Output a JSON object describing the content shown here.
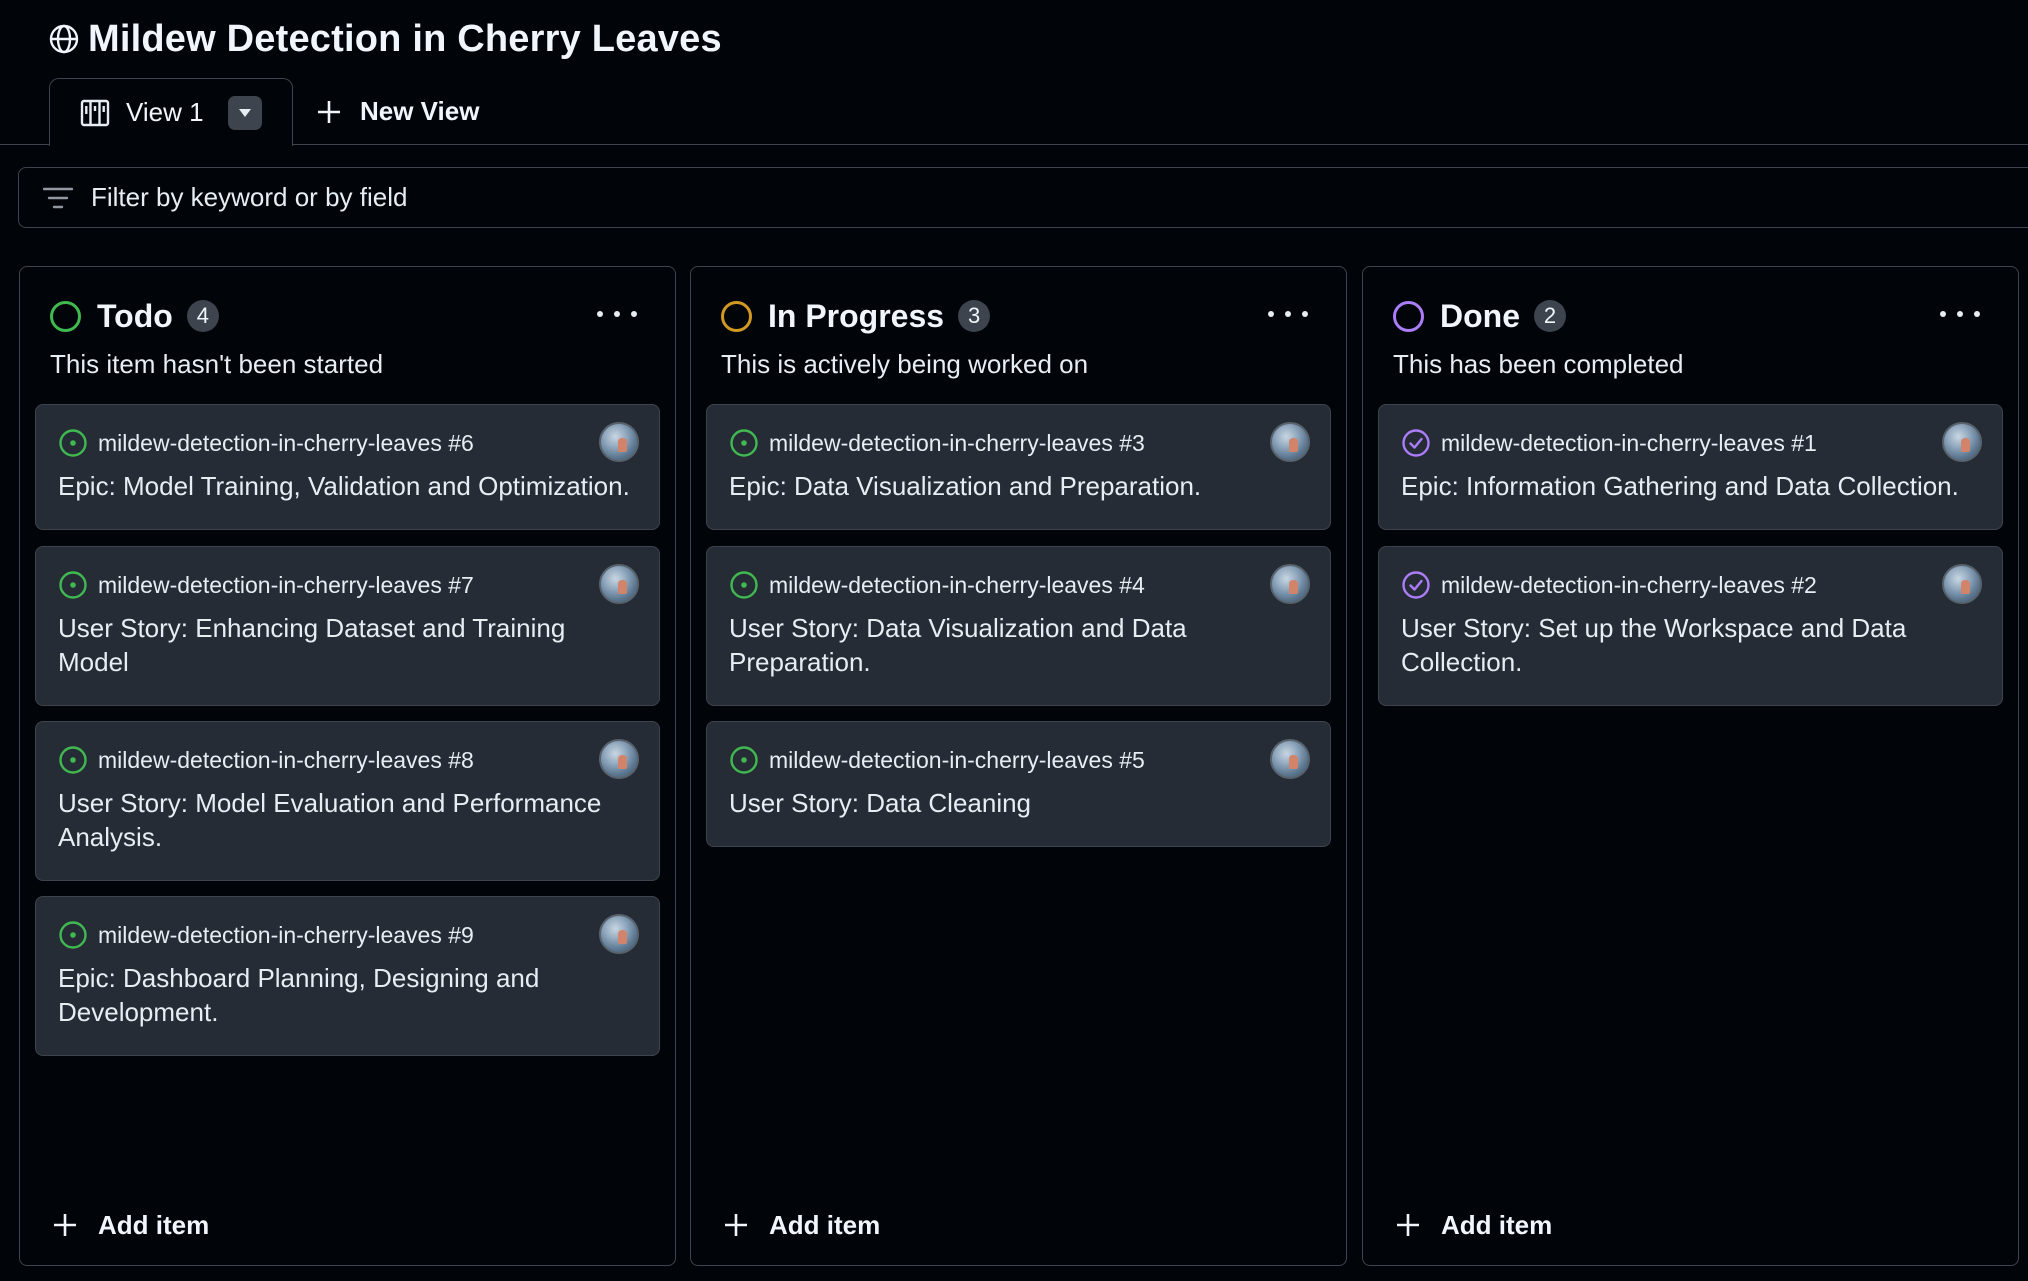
{
  "project": {
    "title": "Mildew Detection in Cherry Leaves"
  },
  "views": {
    "active_label": "View 1",
    "new_view_label": "New View"
  },
  "filter": {
    "placeholder": "Filter by keyword or by field"
  },
  "columns": [
    {
      "name": "Todo",
      "count": "4",
      "description": "This item hasn't been started",
      "status_color": "#3fb950",
      "add_label": "Add item",
      "cards": [
        {
          "ref": "mildew-detection-in-cherry-leaves #6",
          "title": "Epic: Model Training, Validation and Optimization.",
          "state": "open"
        },
        {
          "ref": "mildew-detection-in-cherry-leaves #7",
          "title": "User Story: Enhancing Dataset and Training Model",
          "state": "open"
        },
        {
          "ref": "mildew-detection-in-cherry-leaves #8",
          "title": "User Story: Model Evaluation and Performance Analysis.",
          "state": "open"
        },
        {
          "ref": "mildew-detection-in-cherry-leaves #9",
          "title": "Epic: Dashboard Planning, Designing and Development.",
          "state": "open"
        }
      ]
    },
    {
      "name": "In Progress",
      "count": "3",
      "description": "This is actively being worked on",
      "status_color": "#d29922",
      "add_label": "Add item",
      "cards": [
        {
          "ref": "mildew-detection-in-cherry-leaves #3",
          "title": "Epic: Data Visualization and Preparation.",
          "state": "open"
        },
        {
          "ref": "mildew-detection-in-cherry-leaves #4",
          "title": "User Story: Data Visualization and Data Preparation.",
          "state": "open"
        },
        {
          "ref": "mildew-detection-in-cherry-leaves #5",
          "title": "User Story: Data Cleaning",
          "state": "open"
        }
      ]
    },
    {
      "name": "Done",
      "count": "2",
      "description": "This has been completed",
      "status_color": "#ab7df8",
      "add_label": "Add item",
      "cards": [
        {
          "ref": "mildew-detection-in-cherry-leaves #1",
          "title": "Epic: Information Gathering and Data Collection.",
          "state": "closed"
        },
        {
          "ref": "mildew-detection-in-cherry-leaves #2",
          "title": "User Story: Set up the Workspace and Data Collection.",
          "state": "closed"
        }
      ]
    }
  ],
  "colors": {
    "open_issue": "#3fb950",
    "closed_issue": "#ab7df8",
    "background": "#010409",
    "card": "#262c36",
    "border": "#3d444d"
  },
  "icons": {
    "project": "globe-icon",
    "view": "board-icon",
    "view_menu": "triangle-down-icon",
    "new_view": "plus-icon",
    "filter": "filter-icon",
    "column_menu": "kebab-horizontal-icon",
    "open_issue": "issue-opened-icon",
    "closed_issue": "issue-closed-icon",
    "add": "plus-icon"
  }
}
